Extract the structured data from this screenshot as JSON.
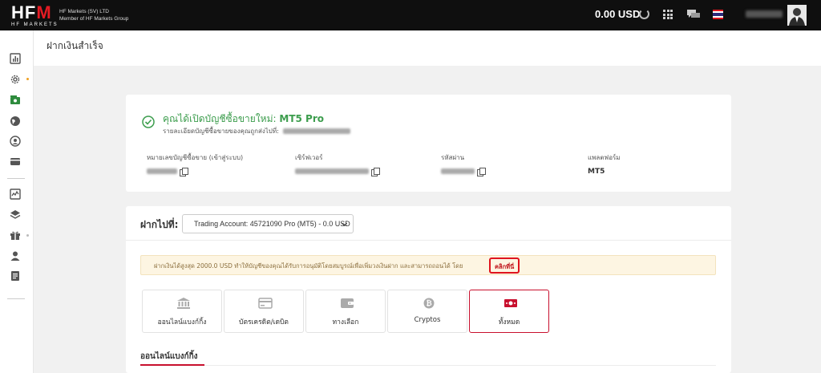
{
  "header": {
    "logo_text": "HFM",
    "logo_sub": "HF MARKETS",
    "company_line1": "HF Markets (SV) LTD",
    "company_line2": "Member of HF Markets Group",
    "balance": "0.00 USD",
    "username": "HFM Workshop"
  },
  "page": {
    "title": "ฝากเงินสำเร็จ"
  },
  "success_card": {
    "title_prefix": "คุณได้เปิดบัญชีซื้อขายใหม่:",
    "title_product": "MT5 Pro",
    "subtitle": "รายละเอียดบัญชีซื้อขายของคุณถูกส่งไปที่:",
    "email": "hfammen850@gmail.com",
    "fields": [
      {
        "label": "หมายเลขบัญชีซื้อขาย (เข้าสู่ระบบ)",
        "value": "45721090"
      },
      {
        "label": "เซิร์ฟเวอร์",
        "value": "HFMarketsGlobal-Live7"
      },
      {
        "label": "รหัสผ่าน",
        "value": "#4Mk1vd9"
      },
      {
        "label": "แพลตฟอร์ม",
        "value": "MT5"
      }
    ]
  },
  "deposit": {
    "label": "ฝากไปที่:",
    "account": "Trading Account: 45721090 Pro (MT5) - 0.0 USD",
    "notice": "ฝากเงินได้สูงสุด 2000.0 USD ทำให้บัญชีของคุณได้รับการอนุมัติโดยสมบูรณ์เพื่อเพิ่มวงเงินฝาก และสามารถถอนได้ โดย",
    "notice_link": "คลิกที่นี่",
    "methods": [
      {
        "label": "ออนไลน์แบงก์กิ้ง",
        "icon": "bank-icon"
      },
      {
        "label": "บัตรเครดิต/เดบิต",
        "icon": "credit-card-icon"
      },
      {
        "label": "ทางเลือก",
        "icon": "wallet-icon"
      },
      {
        "label": "Cryptos",
        "icon": "bitcoin-icon"
      },
      {
        "label": "ทั้งหมด",
        "icon": "money-icon"
      }
    ],
    "section_title": "ออนไลน์แบงก์กิ้ง"
  },
  "colors": {
    "topbar": "#0f0f0f",
    "brand_red": "#c8102e",
    "success_green": "#3c9d4d"
  }
}
